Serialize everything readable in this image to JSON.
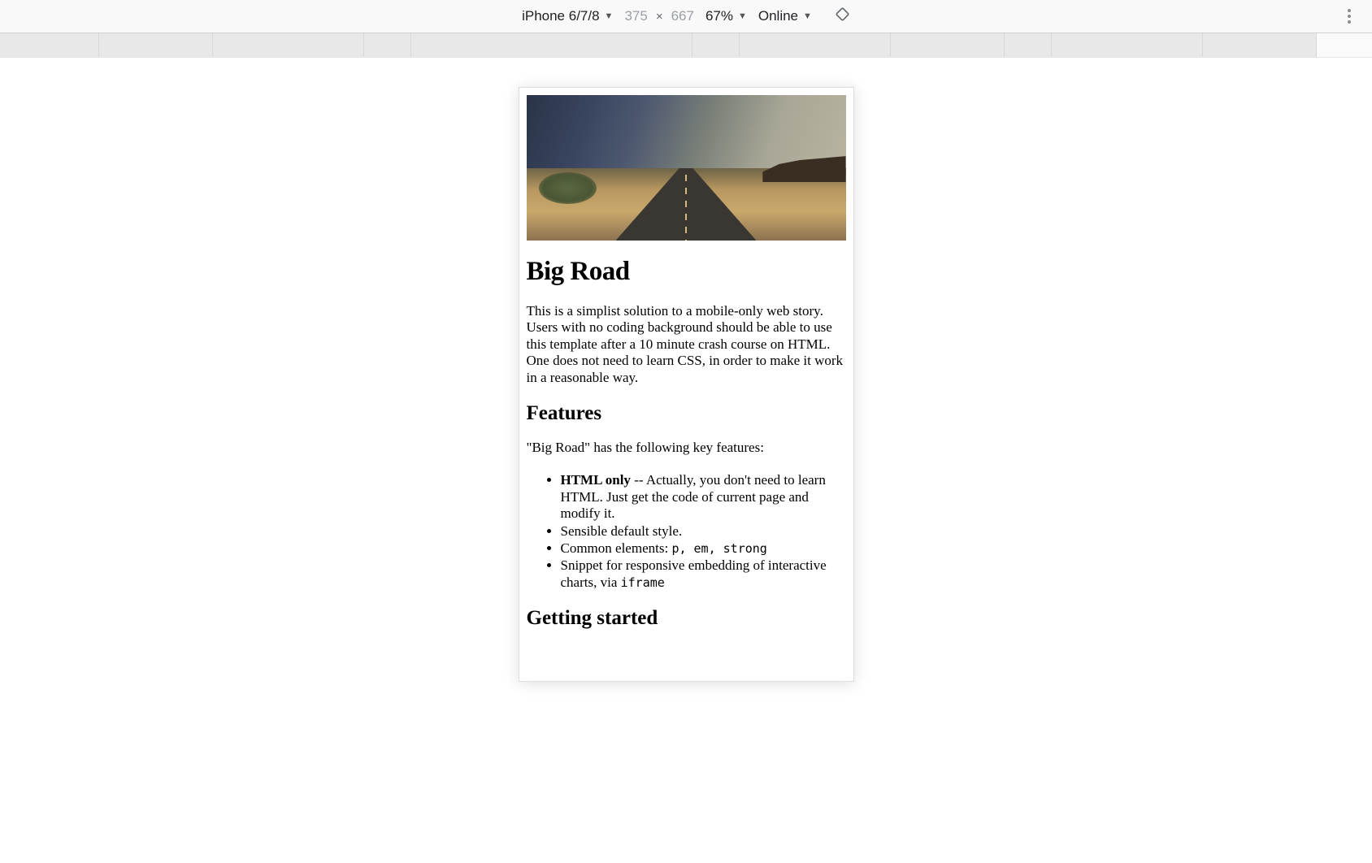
{
  "toolbar": {
    "device": "iPhone 6/7/8",
    "width": "375",
    "height": "667",
    "separator": "×",
    "zoom": "67%",
    "throttle": "Online"
  },
  "ruler": {
    "segments": [
      122,
      140,
      186,
      58,
      346,
      58,
      186,
      140,
      58,
      186,
      140
    ]
  },
  "page": {
    "h1": "Big Road",
    "intro": "This is a simplist solution to a mobile-only web story. Users with no coding background should be able to use this template after a 10 minute crash course on HTML. One does not need to learn CSS, in order to make it work in a reasonable way.",
    "h2_features": "Features",
    "features_intro": "\"Big Road\" has the following key features:",
    "features": [
      {
        "strong": "HTML only",
        "rest": " -- Actually, you don't need to learn HTML. Just get the code of current page and modify it."
      },
      {
        "text": "Sensible default style."
      },
      {
        "prefix": "Common elements: ",
        "code": "p, em, strong"
      },
      {
        "prefix": "Snippet for responsive embedding of interactive charts, via ",
        "code": "iframe"
      }
    ],
    "h2_getting_started": "Getting started"
  }
}
